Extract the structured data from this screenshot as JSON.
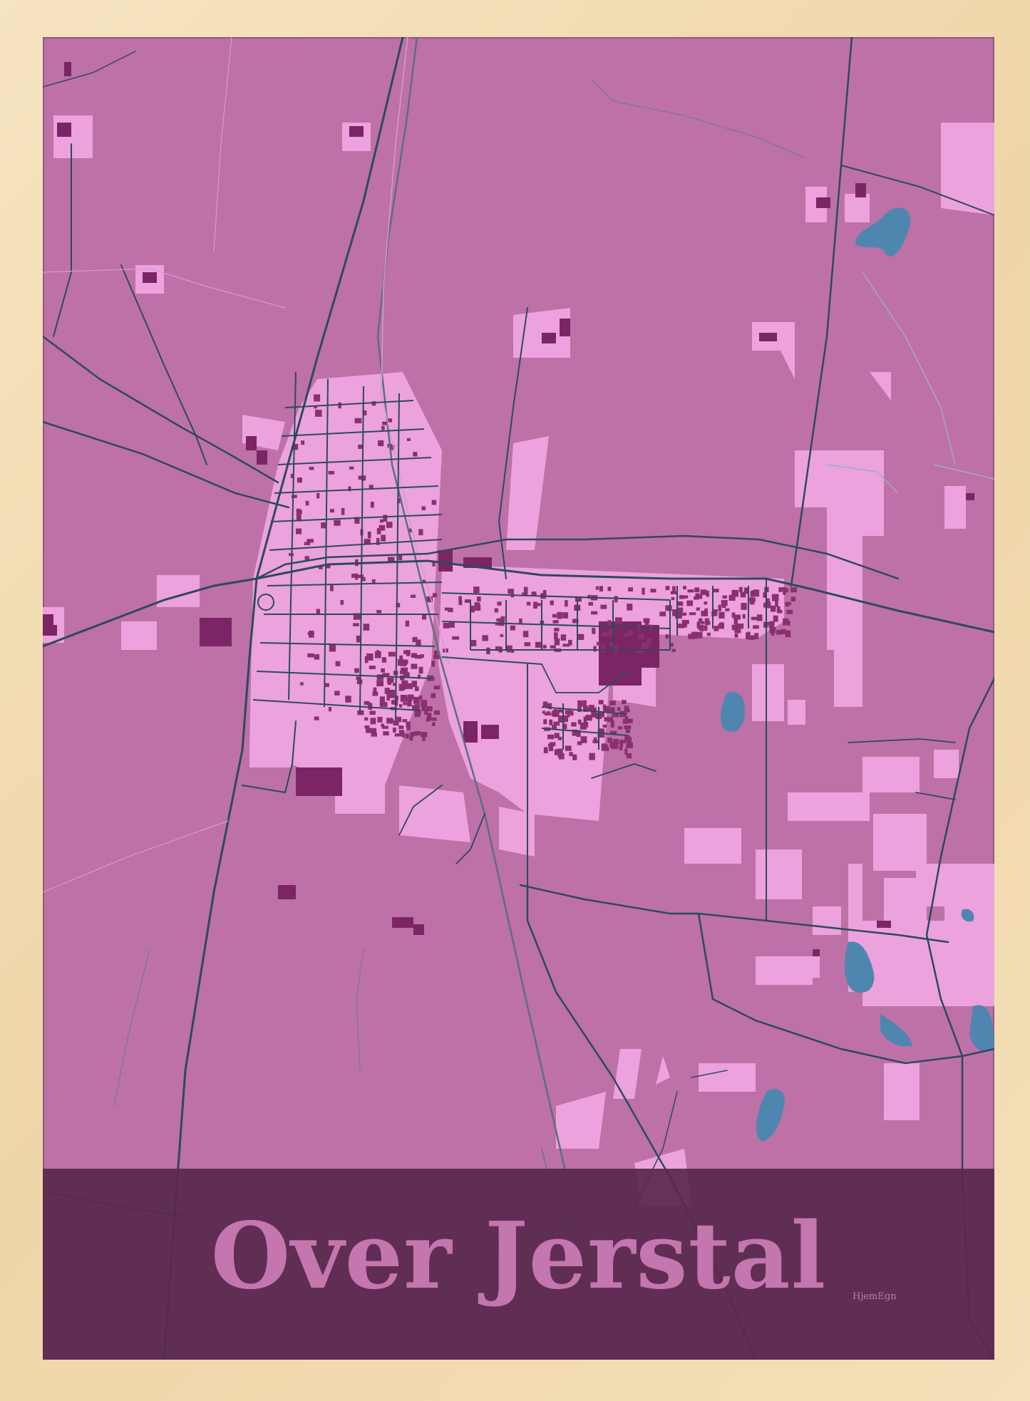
{
  "poster": {
    "place_name": "Over Jerstal",
    "brand": "HjemEgn"
  },
  "colors": {
    "frame": "#f3dcb2",
    "farmland": "#bd71a6",
    "settlement": "#eca2dc",
    "buildings": "#7c2565",
    "roads": "#2d4a5c",
    "water": "#4f86b0",
    "title_band": "#58284e",
    "title_text": "#c476ae"
  }
}
